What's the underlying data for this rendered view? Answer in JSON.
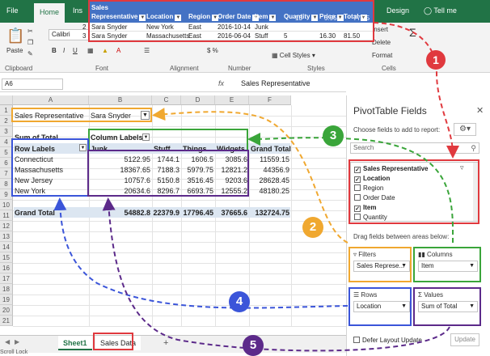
{
  "ribbon": {
    "tabs": {
      "file": "File",
      "home": "Home",
      "insert": "Ins",
      "design": "Design",
      "tellme": "Tell me"
    },
    "clipboard": {
      "label": "Clipboard",
      "paste": "Paste"
    },
    "font": {
      "label": "Font",
      "name": "Calibri",
      "bold": "B",
      "italic": "I",
      "underline": "U"
    },
    "alignment": {
      "label": "Alignment"
    },
    "number": {
      "label": "Number"
    },
    "styles": {
      "label": "Styles",
      "cell_styles": "Cell Styles"
    },
    "cells": {
      "label": "Cells",
      "insert": "Insert",
      "delete": "Delete",
      "format": "Format"
    }
  },
  "formula_bar": {
    "namebox": "A6",
    "fx": "fx",
    "value": "Sales Representative"
  },
  "columns": [
    "A",
    "B",
    "C",
    "D",
    "E",
    "F"
  ],
  "rows": [
    "1",
    "2",
    "3",
    "4",
    "5",
    "6",
    "7",
    "8",
    "9",
    "10",
    "11",
    "12",
    "13",
    "14",
    "15",
    "16",
    "17",
    "18",
    "19",
    "20",
    "21"
  ],
  "pivot_table": {
    "filter_label": "Sales Representative",
    "filter_value": "Sara Snyder",
    "sum_label": "Sum of Total",
    "col_labels": "Column Labels",
    "row_labels": "Row Labels",
    "col_headers": [
      "Junk",
      "Stuff",
      "Things",
      "Widgets",
      "Grand Total"
    ],
    "data_rows": [
      {
        "label": "Connecticut",
        "values": [
          "5122.95",
          "1744.1",
          "1606.5",
          "3085.6",
          "11559.15"
        ]
      },
      {
        "label": "Massachusetts",
        "values": [
          "18367.65",
          "7188.3",
          "5979.75",
          "12821.2",
          "44356.9"
        ]
      },
      {
        "label": "New Jersey",
        "values": [
          "10757.6",
          "5150.8",
          "3516.45",
          "9203.6",
          "28628.45"
        ]
      },
      {
        "label": "New York",
        "values": [
          "20634.6",
          "8296.7",
          "6693.75",
          "12555.2",
          "48180.25"
        ]
      }
    ],
    "grand_total": {
      "label": "Grand Total",
      "values": [
        "54882.8",
        "22379.9",
        "17796.45",
        "37665.6",
        "132724.75"
      ]
    }
  },
  "callout_table": {
    "headers": [
      "Sales Representative",
      "Location",
      "Region",
      "Order Date",
      "Item",
      "Quantity",
      "Price",
      "Total"
    ],
    "rows": [
      {
        "rownum": "2",
        "cells": [
          "Sara Snyder",
          "New York",
          "East",
          "2016-10-14",
          "Junk",
          "",
          "",
          ""
        ]
      },
      {
        "rownum": "3",
        "cells": [
          "Sara Snyder",
          "Massachusetts",
          "East",
          "2016-06-04",
          "Stuff",
          "5",
          "16.30",
          "81.50"
        ]
      }
    ],
    "partial_row": [
      "13",
      "5.95",
      "77.35"
    ]
  },
  "pivot_panel": {
    "title": "PivotTable Fields",
    "choose_text": "Choose fields to add to report:",
    "search_placeholder": "Search",
    "fields": [
      {
        "name": "Sales Representative",
        "checked": true
      },
      {
        "name": "Location",
        "checked": true
      },
      {
        "name": "Region",
        "checked": false
      },
      {
        "name": "Order Date",
        "checked": false
      },
      {
        "name": "Item",
        "checked": true
      },
      {
        "name": "Quantity",
        "checked": false
      }
    ],
    "drag_text": "Drag fields between areas below:",
    "areas": {
      "filters": {
        "title": "Filters",
        "value": "Sales Represe..."
      },
      "columns": {
        "title": "Columns",
        "value": "Item"
      },
      "rows": {
        "title": "Rows",
        "value": "Location"
      },
      "values": {
        "title": "Values",
        "value": "Sum of Total"
      }
    },
    "defer_label": "Defer Layout Update",
    "update_label": "Update"
  },
  "sheet_tabs": {
    "sheet1": "Sheet1",
    "sales": "Sales Data",
    "add": "+"
  },
  "status": "Scroll Lock",
  "callouts": [
    "1",
    "2",
    "3",
    "4",
    "5"
  ],
  "colors": {
    "excel_green": "#217346",
    "red": "#e0393e",
    "orange": "#f0a830",
    "green": "#3aa53a",
    "blue": "#3b55d9",
    "purple": "#5c2a8a",
    "pivot_header": "#dce6f1"
  }
}
